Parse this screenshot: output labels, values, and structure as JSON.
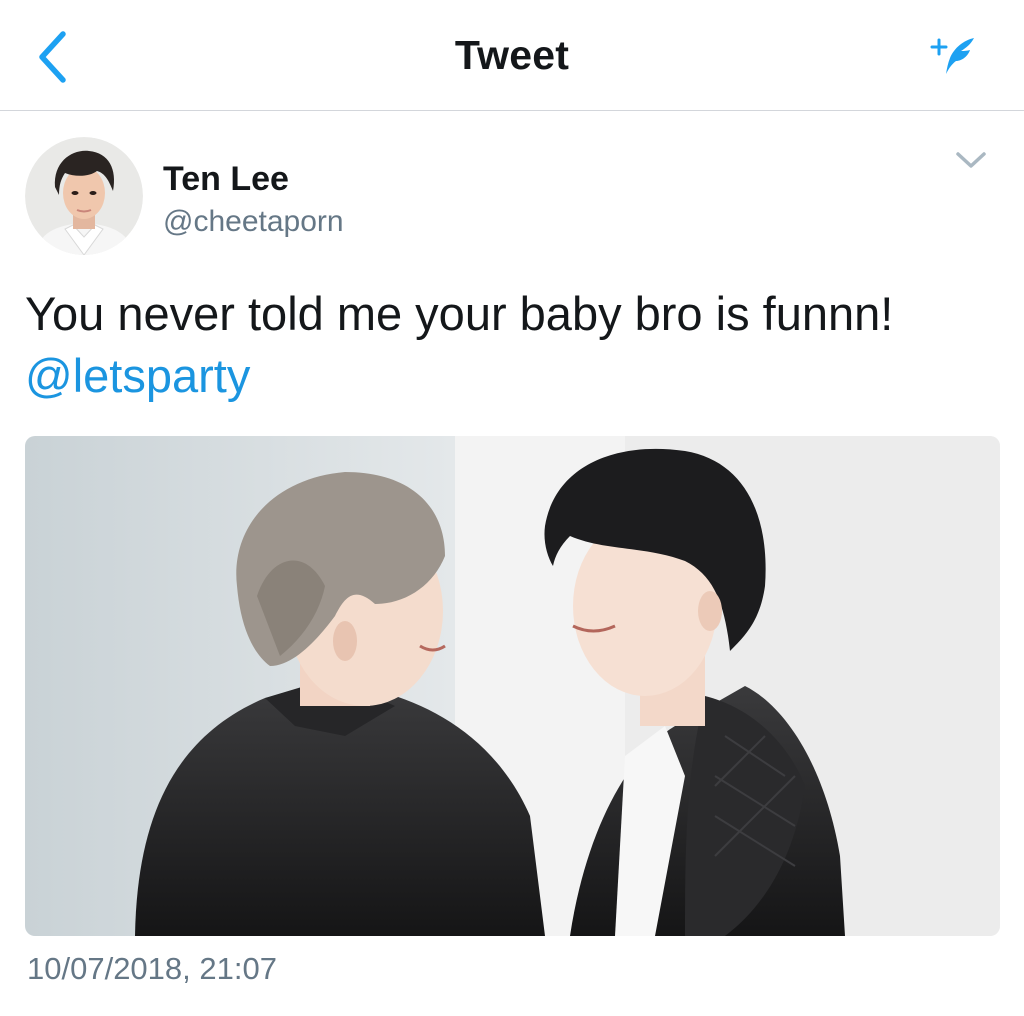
{
  "header": {
    "title": "Tweet",
    "back_icon": "chevron-left-icon",
    "compose_icon": "compose-tweet-icon",
    "accent_color": "#1da1f2"
  },
  "tweet": {
    "author": {
      "name": "Ten Lee",
      "handle": "@cheetaporn"
    },
    "text": "You never told me your baby bro is funnn!",
    "mention": "@letsparty",
    "timestamp": "10/07/2018, 21:07",
    "caret_icon": "chevron-down-icon",
    "media_description": "photo"
  },
  "colors": {
    "text": "#14171a",
    "secondary": "#657786",
    "link": "#1b95e0",
    "divider": "#d3d6db"
  }
}
